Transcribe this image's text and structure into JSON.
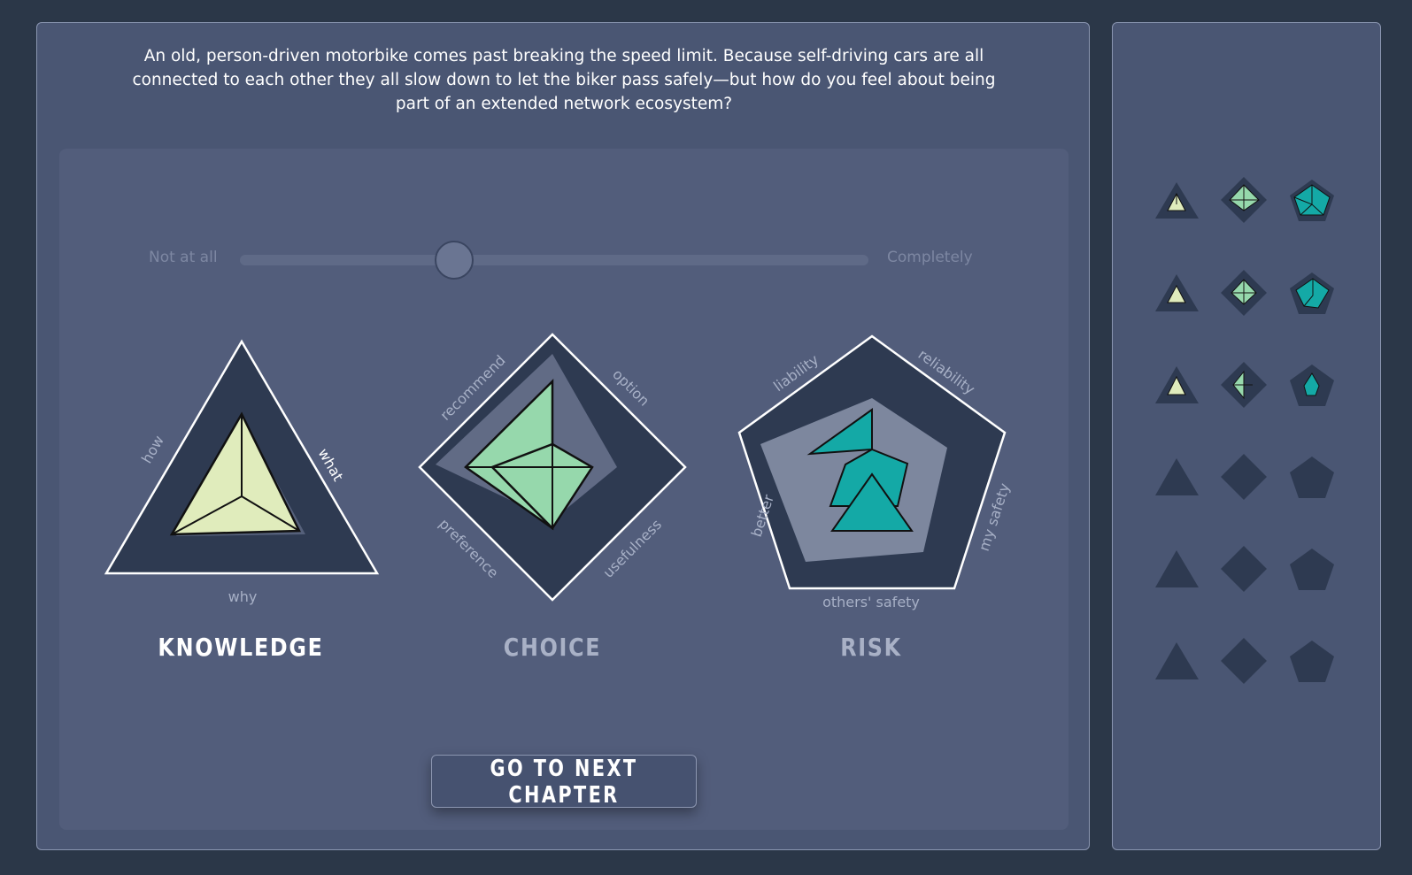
{
  "question": "An old, person-driven motorbike comes past breaking the speed limit. Because self-driving cars are all connected to each other they all slow down to let the biker pass safely—but how do you feel about being part of an extended network ecosystem?",
  "slider": {
    "min_label": "Not at all",
    "max_label": "Completely",
    "value": 0.33
  },
  "colors": {
    "background": "#2b3748",
    "panel": "#4a5673",
    "shape_dark": "#2e3a51",
    "knowledge_fill": "#e0ecbc",
    "choice_fill": "#96d8ac",
    "risk_fill": "#14a9a6",
    "active_title": "#ffffff",
    "inactive_title": "#a9b1c6"
  },
  "charts": [
    {
      "key": "knowledge",
      "title": "KNOWLEDGE",
      "active": true,
      "axes": [
        "what",
        "why",
        "how"
      ]
    },
    {
      "key": "choice",
      "title": "CHOICE",
      "active": false,
      "axes": [
        "option",
        "usefulness",
        "preference",
        "recommend"
      ]
    },
    {
      "key": "risk",
      "title": "RISK",
      "active": false,
      "axes": [
        "reliability",
        "my safety",
        "others' safety",
        "better",
        "liability"
      ]
    }
  ],
  "next_button": {
    "label": "GO TO NEXT CHAPTER"
  },
  "history": {
    "rows": [
      [
        "filled",
        "filled",
        "filled"
      ],
      [
        "filled",
        "filled",
        "filled"
      ],
      [
        "filled",
        "filled",
        "filled"
      ],
      [
        "empty",
        "empty",
        "empty"
      ],
      [
        "empty",
        "empty",
        "empty"
      ],
      [
        "empty",
        "empty",
        "empty"
      ]
    ]
  }
}
